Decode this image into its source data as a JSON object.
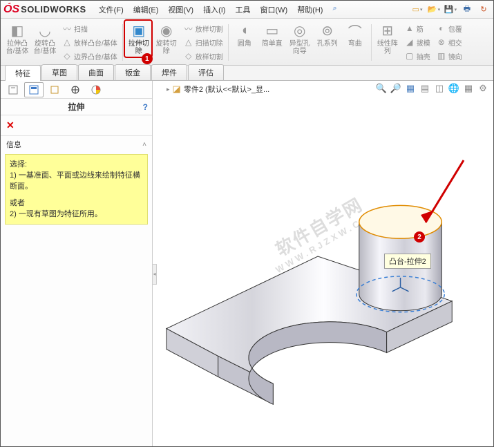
{
  "app": {
    "name": "SOLIDWORKS"
  },
  "menu": [
    "文件(F)",
    "编辑(E)",
    "视图(V)",
    "插入(I)",
    "工具",
    "窗口(W)",
    "帮助(H)"
  ],
  "ribbon": {
    "boss_extrude": "拉伸凸\n台/基体",
    "boss_revolve": "旋转凸\n台/基体",
    "sweep": "扫描",
    "loft": "放样凸台/基体",
    "boundary": "边界凸台/基体",
    "cut_extrude": "拉伸切\n除",
    "cut_revolve": "旋转切\n除",
    "cut_sweep": "放样切割",
    "cut_sweep2": "扫描切除",
    "cut_loft": "放样切割",
    "fillet": "圆角",
    "simple": "简单直",
    "hole": "异型孔\n向导",
    "hole_series": "孔系列",
    "bend": "弯曲",
    "pattern": "线性阵\n列",
    "rib": "筋",
    "draft": "拔模",
    "shell": "抽壳",
    "wrap": "包覆",
    "intersect": "相交",
    "mirror": "镜向"
  },
  "tabs": [
    "特征",
    "草图",
    "曲面",
    "钣金",
    "焊件",
    "评估"
  ],
  "pm": {
    "title": "拉伸",
    "section": "信息",
    "info_select": "选择:",
    "info_line1": "1) 一基准面、平面或边线来绘制特征横断面。",
    "info_or": "或者",
    "info_line2": "2) 一现有草图为特征所用。"
  },
  "breadcrumb": {
    "part": "零件2 (默认<<默认>_显..."
  },
  "tooltip": "凸台-拉伸2",
  "watermark": {
    "line1": "软件自学网",
    "line2": "WWW.RJZXW.COM"
  },
  "badges": {
    "one": "1",
    "two": "2"
  }
}
